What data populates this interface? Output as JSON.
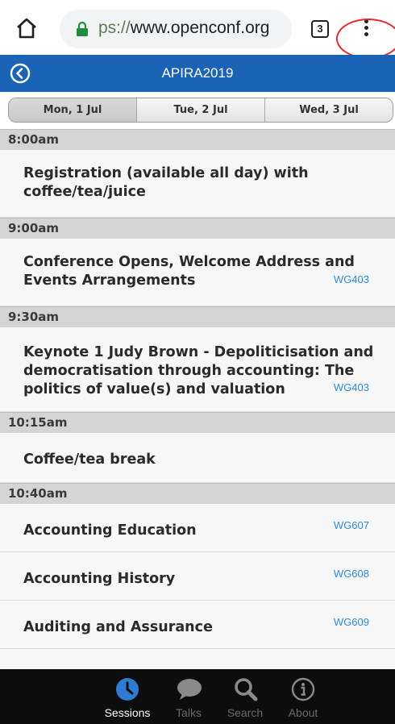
{
  "browser": {
    "url_scheme": "ps://",
    "url_host": "www.openconf.org",
    "tab_count": "3"
  },
  "header": {
    "title": "APIRA2019"
  },
  "day_tabs": [
    {
      "label": "Mon, 1 Jul",
      "active": true
    },
    {
      "label": "Tue, 2 Jul",
      "active": false
    },
    {
      "label": "Wed, 3 Jul",
      "active": false
    }
  ],
  "schedule": {
    "time_slots": [
      "8:00am",
      "9:00am",
      "9:30am",
      "10:15am",
      "10:40am"
    ],
    "sessions": [
      {
        "title_lines": [
          "Registration (available all day) with",
          "coffee/tea/juice"
        ],
        "room": ""
      },
      {
        "title_lines": [
          "Conference Opens, Welcome Address and",
          "Events Arrangements"
        ],
        "room": "WG403"
      },
      {
        "title_lines": [
          "Keynote 1 Judy Brown - Depoliticisation and",
          "democratisation through accounting: The",
          "politics of value(s) and valuation"
        ],
        "room": "WG403"
      },
      {
        "title_lines": [
          "Coffee/tea break"
        ],
        "room": ""
      },
      {
        "title_lines": [
          "Accounting Education"
        ],
        "room": "WG607"
      },
      {
        "title_lines": [
          "Accounting History"
        ],
        "room": "WG608"
      },
      {
        "title_lines": [
          "Auditing and Assurance"
        ],
        "room": "WG609"
      }
    ]
  },
  "bottom_nav": [
    {
      "label": "Sessions",
      "icon": "clock-icon",
      "active": true
    },
    {
      "label": "Talks",
      "icon": "chat-bubble-icon",
      "active": false
    },
    {
      "label": "Search",
      "icon": "search-icon",
      "active": false
    },
    {
      "label": "About",
      "icon": "info-icon",
      "active": false
    }
  ],
  "colors": {
    "header_blue": "#1b63b7",
    "room_link": "#2b8ad6",
    "highlight_circle": "#e8262b"
  }
}
